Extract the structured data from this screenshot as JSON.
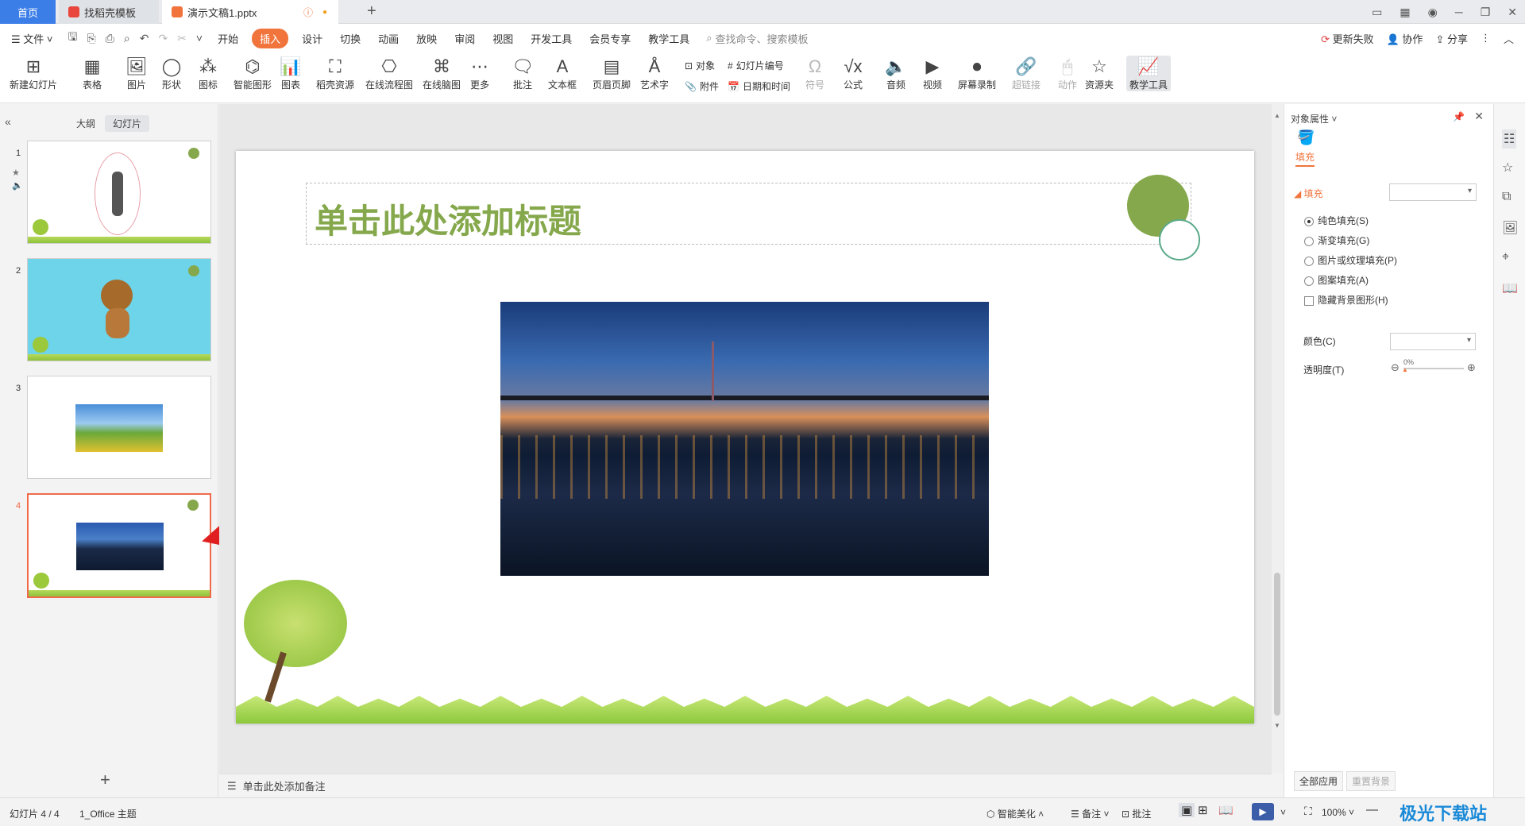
{
  "titlebar": {
    "home_tab": "首页",
    "template_tab": "找稻壳模板",
    "doc_tab": "演示文稿1.pptx",
    "new_tab": "+"
  },
  "menu": {
    "file": "文件",
    "items": [
      "开始",
      "插入",
      "设计",
      "切换",
      "动画",
      "放映",
      "审阅",
      "视图",
      "开发工具",
      "会员专享",
      "教学工具"
    ],
    "active_item": "插入",
    "search_placeholder": "查找命令、搜索模板",
    "update_fail": "更新失败",
    "collab": "协作",
    "share": "分享"
  },
  "ribbon": {
    "new_slide": "新建幻灯片",
    "table": "表格",
    "picture": "图片",
    "shape": "形状",
    "icon": "图标",
    "smart_art": "智能图形",
    "chart": "图表",
    "docer_res": "稻壳资源",
    "flowchart": "在线流程图",
    "mindmap": "在线脑图",
    "more": "更多",
    "comment": "批注",
    "textbox": "文本框",
    "header_footer": "页眉页脚",
    "wordart": "艺术字",
    "object": "对象",
    "attachment": "附件",
    "slide_number": "幻灯片编号",
    "datetime": "日期和时间",
    "symbol": "符号",
    "formula": "公式",
    "audio": "音频",
    "video": "视频",
    "screen_record": "屏幕录制",
    "hyperlink": "超链接",
    "action": "动作",
    "resource_folder": "资源夹",
    "teaching_tools": "教学工具"
  },
  "left_panel": {
    "outline_tab": "大纲",
    "slides_tab": "幻灯片",
    "slide_numbers": [
      "1",
      "2",
      "3",
      "4"
    ],
    "add_label": "+"
  },
  "slide": {
    "title_placeholder": "单击此处添加标题"
  },
  "notes": {
    "placeholder": "单击此处添加备注"
  },
  "properties": {
    "panel_title": "对象属性",
    "tab_fill": "填充",
    "section_fill": "填充",
    "options": [
      "纯色填充(S)",
      "渐变填充(G)",
      "图片或纹理填充(P)",
      "图案填充(A)"
    ],
    "hide_bg": "隐藏背景图形(H)",
    "color_label": "颜色(C)",
    "transparency_label": "透明度(T)",
    "transparency_value": "0%",
    "apply_all": "全部应用",
    "reset_bg": "重置背景"
  },
  "status": {
    "slide_info": "幻灯片 4 / 4",
    "theme": "1_Office 主题",
    "smart_beautify": "智能美化",
    "notes_btn": "备注",
    "comment_btn": "批注",
    "zoom": "100%"
  },
  "watermark": "极光下载站",
  "colors": {
    "accent": "#f0743c",
    "home_tab": "#3c7ee8",
    "title_green": "#86a84c",
    "selected_border": "#f06a4a",
    "arrow_red": "#e02020"
  }
}
